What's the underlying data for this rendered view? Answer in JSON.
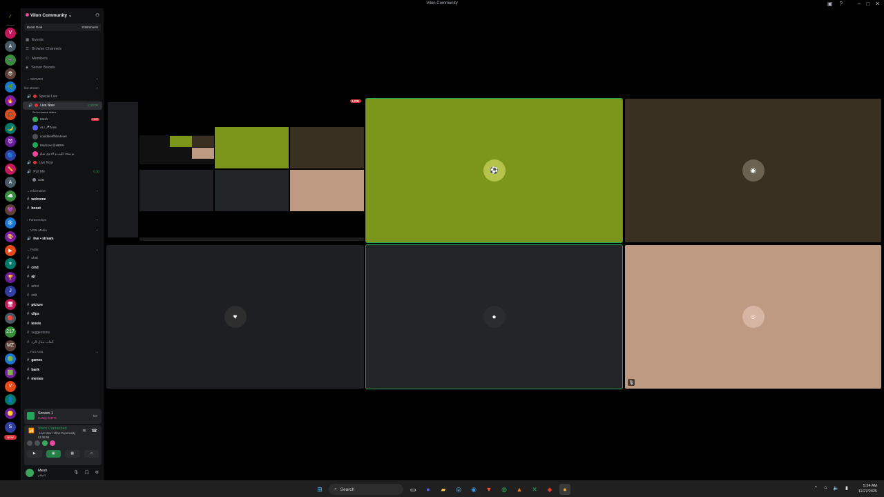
{
  "window": {
    "title": "Vilon Community"
  },
  "server": {
    "name": "Vilon Community",
    "boost_goal": "Boost Goal",
    "boosts": "2/28 Boosts"
  },
  "nav": {
    "events": "Events",
    "browse": "Browse Channels",
    "members": "Members",
    "boosts": "Server Boosts"
  },
  "categories": {
    "server": "SERVER",
    "live": "live stream",
    "information": "Information",
    "partnerships": "Partnerships",
    "vgm": "VGM Media",
    "public": "Public",
    "fun": "Fun Area"
  },
  "voice_channels": {
    "special": "Special Live",
    "live_now": "Live Now",
    "live_now_time": "1:10:00",
    "status_hint": "Set a channel status",
    "live_now2": "Live Now",
    "pull_me": "Pull Me",
    "pull_me_time": "0:30"
  },
  "voice_users": [
    {
      "name": "Mesh",
      "badge": "LIVE"
    },
    {
      "name": "AL! 🎤Zone"
    },
    {
      "name": "couldbeoffline4ever"
    },
    {
      "name": "Modcow @HBHK"
    },
    {
      "name": "يو شحذ كليب و لاه وي شاو"
    }
  ],
  "pull_user": "SXB",
  "text_channels": {
    "welcome": "welcome",
    "boost": "boost",
    "live_stream": "live • stream",
    "chat": "chat",
    "cmd": "cmd",
    "ajr": "ajr",
    "artist": "artist",
    "edit": "edit",
    "picture": "picture",
    "clips": "clips",
    "levels": "levels",
    "suggestions": "suggestions",
    "arabic": "العاب-نبيال-الرد",
    "games": "games",
    "bank": "bank",
    "memes": "memes"
  },
  "screen_panel": {
    "title": "Screen 1",
    "sub": "In Way 40FPS"
  },
  "voice_panel": {
    "status": "Voice Connected",
    "channel": "Live Now / Vilon Community",
    "time": "01:08:56"
  },
  "user": {
    "name": "Mesh",
    "status": "السلام"
  },
  "stage": {
    "live_tag": "LIVE"
  },
  "taskbar": {
    "search": "Search",
    "time": "5:24 AM",
    "date": "11/27/2025"
  },
  "colors": {
    "green_tile": "#7b961b",
    "brown_tile": "#3a3022",
    "peach_tile": "#be9a83",
    "dark_tile": "#1e1f22",
    "slate_tile": "#222628",
    "accent": "#23a55a",
    "live_red": "#da373c"
  },
  "servers_rail": [
    "V",
    "A",
    "🎮",
    "😎",
    "🌿",
    "🔥",
    "🎧",
    "🌙",
    "😈",
    "🔵",
    "✏️",
    "A",
    "☁️",
    "💜",
    "❄️",
    "🎨",
    "▶",
    "⚜",
    "🏆",
    "J",
    "🖥",
    "🔴",
    "217",
    "MZ",
    "🟢",
    "🟩",
    "V",
    "👤",
    "🟡",
    "S"
  ],
  "rail_new": "NEW"
}
